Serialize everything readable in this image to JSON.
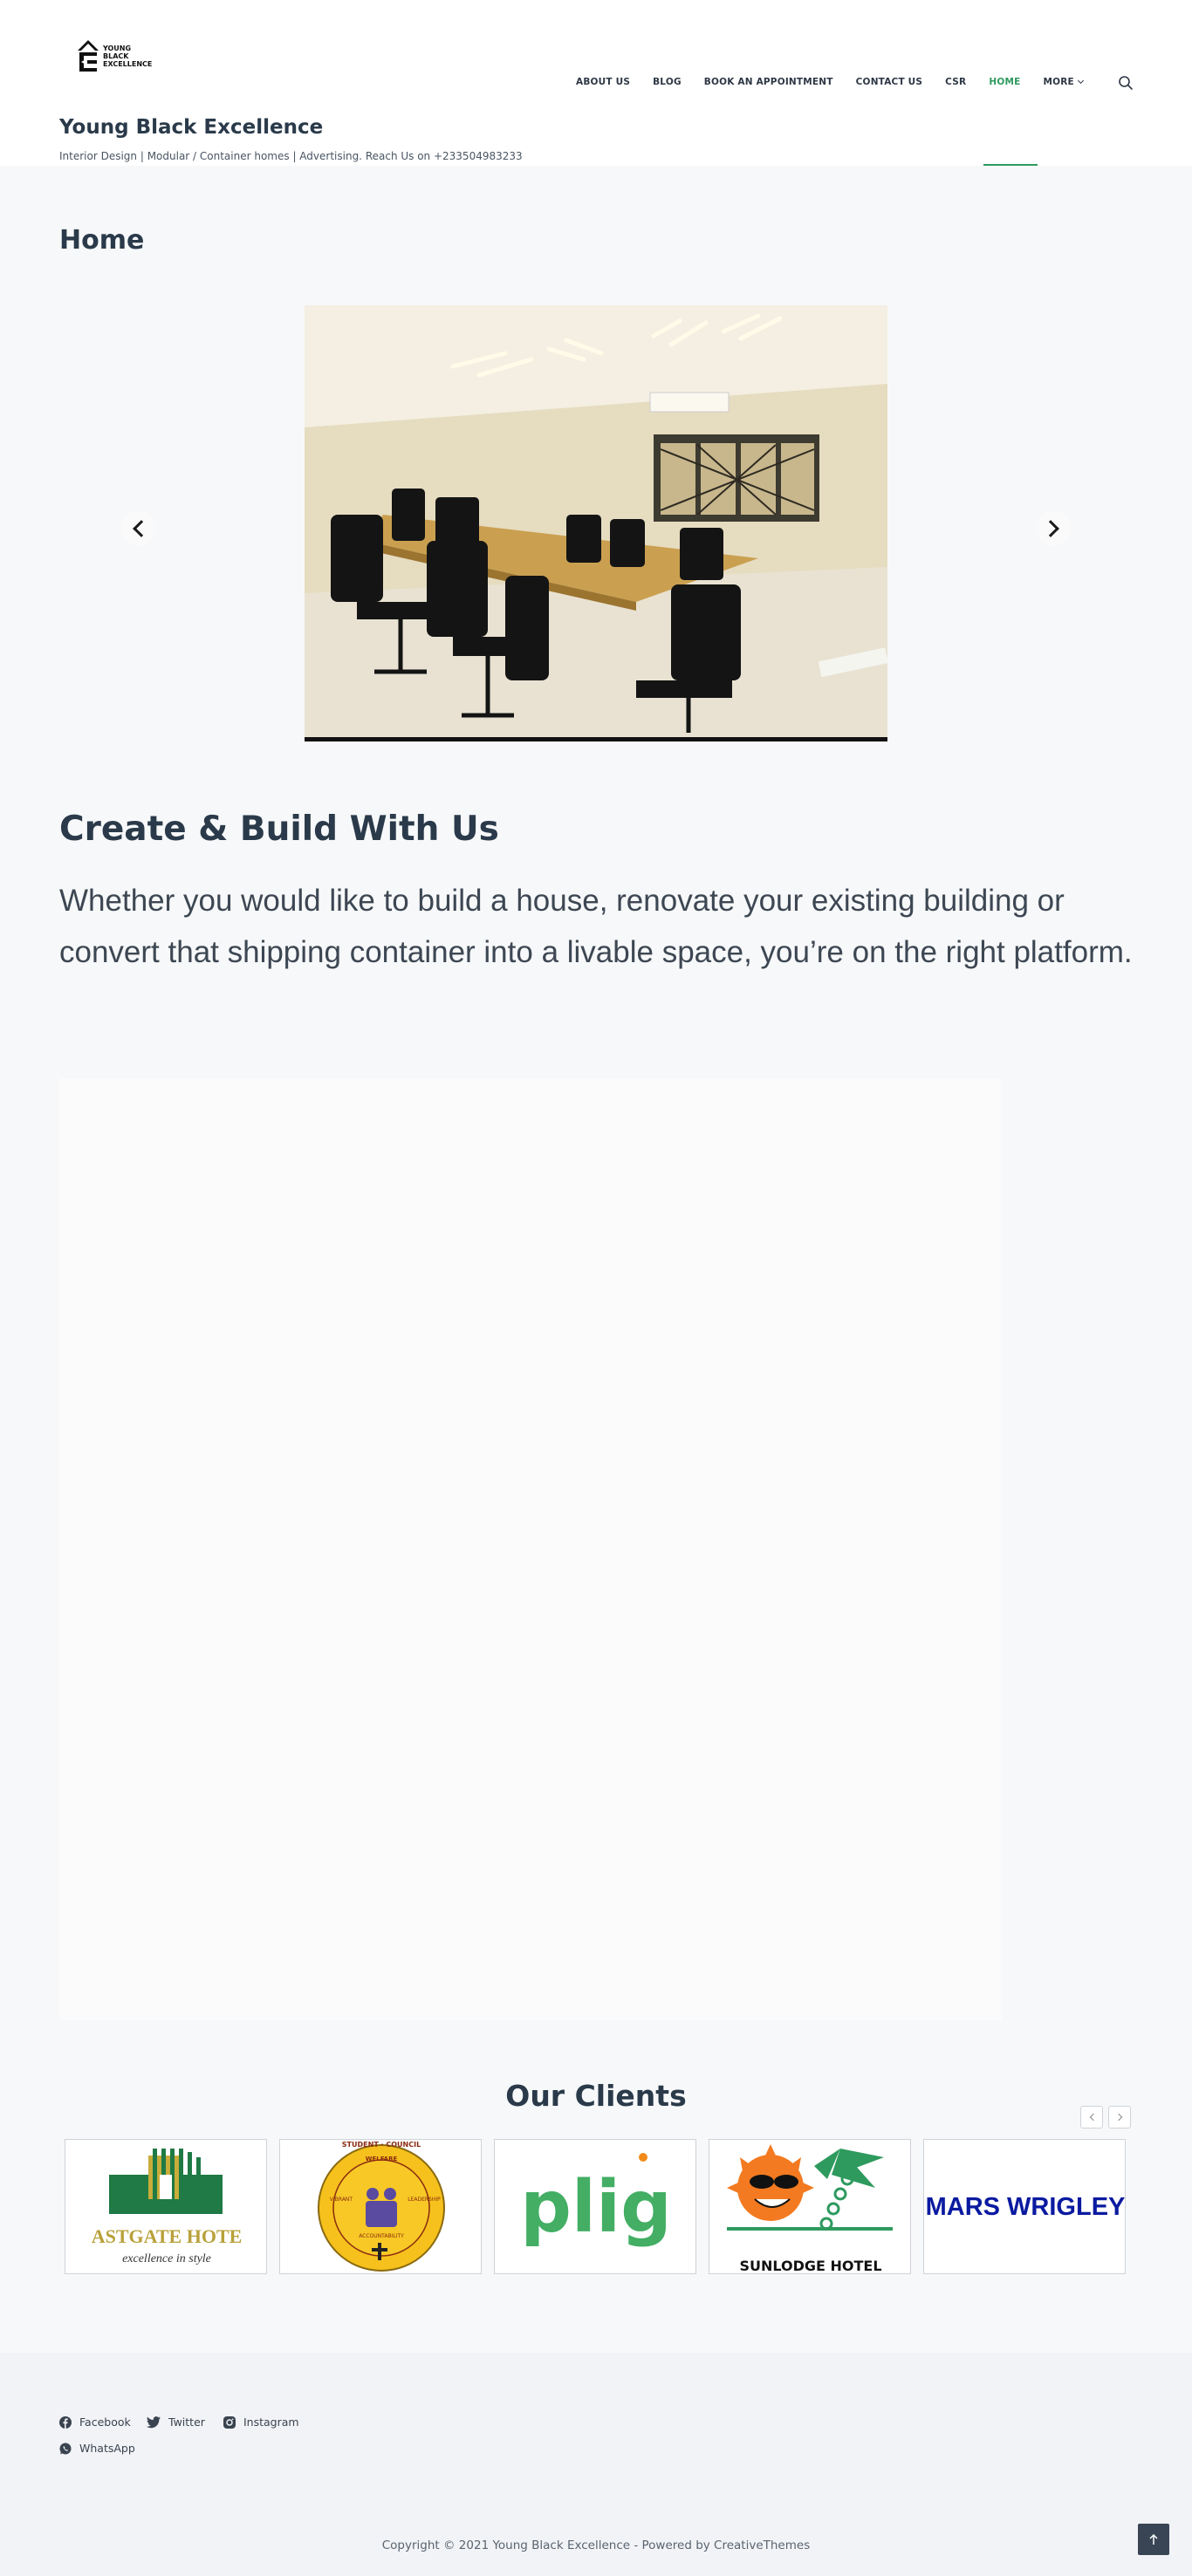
{
  "brand": {
    "logo_text": [
      "YOUNG",
      "BLACK",
      "EXCELLENCE"
    ],
    "title": "Young Black Excellence",
    "tagline": "Interior Design | Modular / Container homes | Advertising. Reach Us on +233504983233"
  },
  "nav": {
    "items": [
      {
        "label": "ABOUT US"
      },
      {
        "label": "BLOG"
      },
      {
        "label": "BOOK AN APPOINTMENT"
      },
      {
        "label": "CONTACT US"
      },
      {
        "label": "CSR"
      },
      {
        "label": "HOME",
        "active": true
      },
      {
        "label": "MORE"
      }
    ],
    "search_icon": "search-icon",
    "accent_color": "#2e9a5e"
  },
  "page": {
    "title": "Home"
  },
  "slider": {
    "prev_icon": "chevron-left-icon",
    "next_icon": "chevron-right-icon"
  },
  "intro": {
    "heading": "Create & Build With Us",
    "text": "Whether you would like to build a house, renovate your existing building or convert that shipping container into a livable space, you’re on the right platform."
  },
  "clients": {
    "title": "Our Clients",
    "logos": [
      {
        "name": "EASTGATE HOTEL",
        "text": "ASTGATE HOTE",
        "subtitle": "excellence in style"
      },
      {
        "name": "Student Welfare Council",
        "text": "WELFARE",
        "ring": "STUDENT · COUNCIL",
        "labels": [
          "VIBRANT",
          "LEADERSHIP",
          "ACCOUNTABILITY"
        ]
      },
      {
        "name": "plig",
        "text": "plig"
      },
      {
        "name": "SUNLODGE HOTEL",
        "text": "SUNLODGE HOTEL"
      },
      {
        "name": "MARS WRIGLEY",
        "text": "MARS WRIGLEY"
      }
    ]
  },
  "footer": {
    "social": [
      {
        "label": "Facebook",
        "icon": "facebook-icon"
      },
      {
        "label": "Twitter",
        "icon": "twitter-icon"
      },
      {
        "label": "Instagram",
        "icon": "instagram-icon"
      },
      {
        "label": "WhatsApp",
        "icon": "whatsapp-icon"
      }
    ],
    "copyright": "Copyright © 2021 Young Black Excellence - Powered by CreativeThemes",
    "back_to_top_icon": "arrow-up-icon"
  }
}
